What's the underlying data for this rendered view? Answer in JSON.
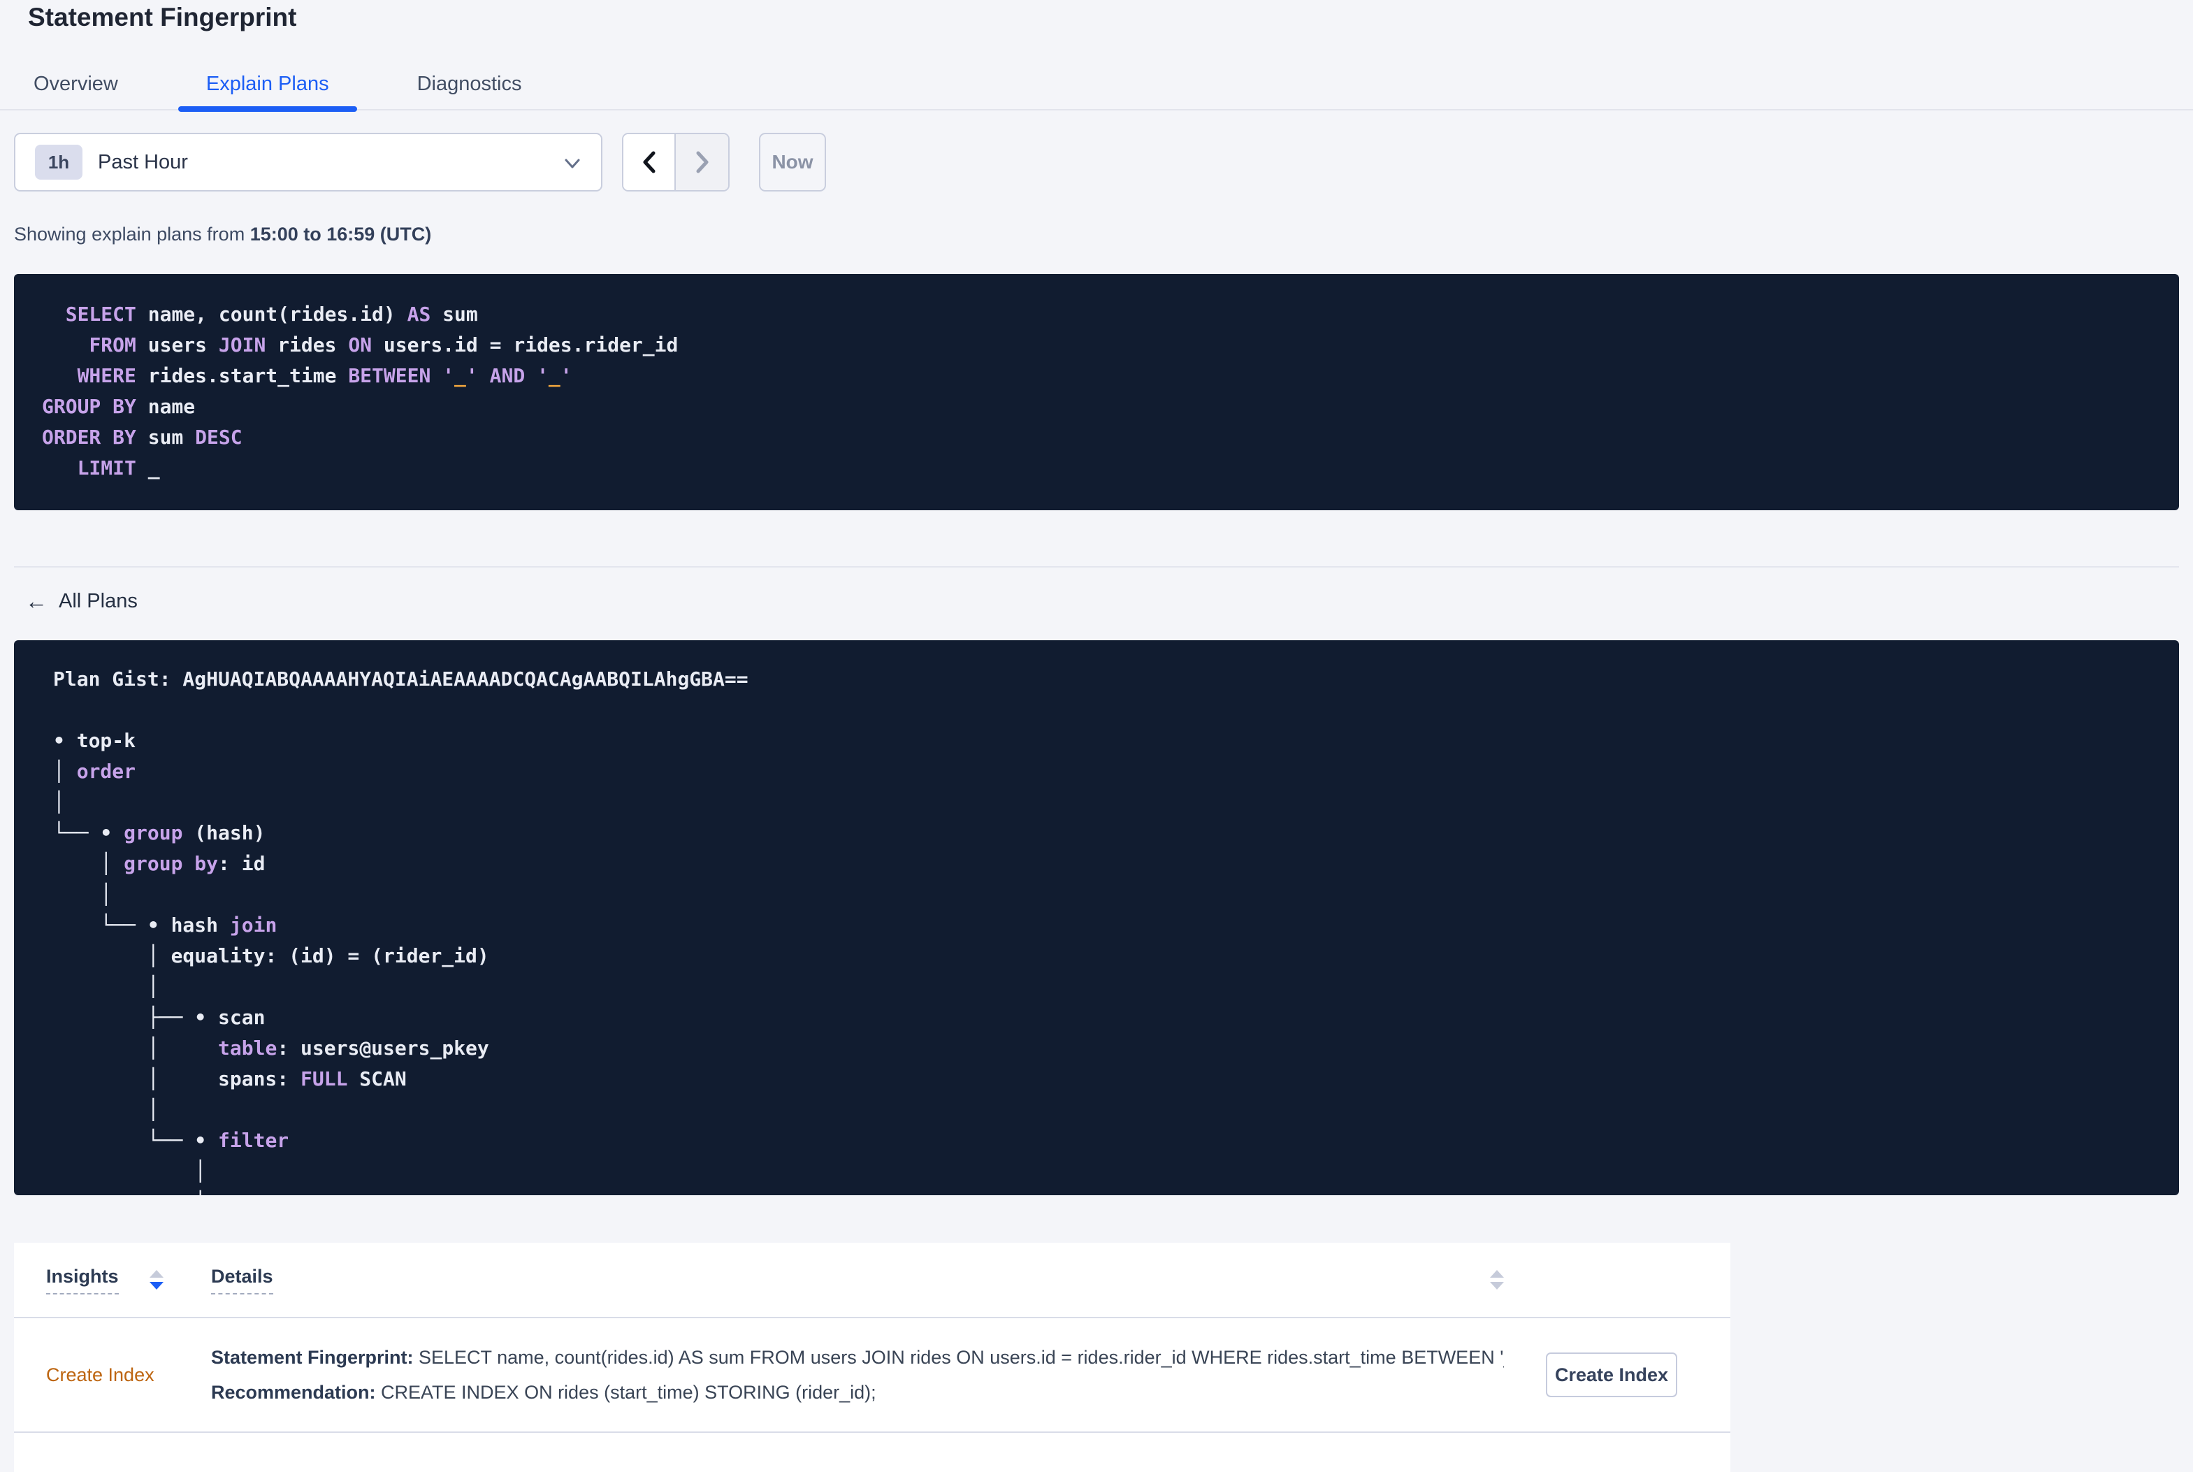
{
  "page": {
    "title": "Statement Fingerprint"
  },
  "tabs": {
    "items": [
      {
        "label": "Overview"
      },
      {
        "label": "Explain Plans"
      },
      {
        "label": "Diagnostics"
      }
    ],
    "active_label": "Explain Plans"
  },
  "time_controls": {
    "range_badge": "1h",
    "range_label": "Past Hour",
    "now_label": "Now"
  },
  "subtitle": {
    "prefix": "Showing explain plans from ",
    "range_bold": "15:00 to 16:59 (UTC)"
  },
  "sql_block": {
    "lines": [
      [
        {
          "t": "  ",
          "c": "i"
        },
        {
          "t": "SELECT",
          "c": "k"
        },
        {
          "t": " name, count(rides.id) ",
          "c": "i"
        },
        {
          "t": "AS",
          "c": "k"
        },
        {
          "t": " sum",
          "c": "i"
        }
      ],
      [
        {
          "t": "    ",
          "c": "i"
        },
        {
          "t": "FROM",
          "c": "k"
        },
        {
          "t": " users ",
          "c": "i"
        },
        {
          "t": "JOIN",
          "c": "k"
        },
        {
          "t": " rides ",
          "c": "i"
        },
        {
          "t": "ON",
          "c": "k"
        },
        {
          "t": " users.id = rides.rider_id",
          "c": "i"
        }
      ],
      [
        {
          "t": "   ",
          "c": "i"
        },
        {
          "t": "WHERE",
          "c": "k"
        },
        {
          "t": " rides.start_time ",
          "c": "i"
        },
        {
          "t": "BETWEEN",
          "c": "k"
        },
        {
          "t": " ",
          "c": "i"
        },
        {
          "t": "'",
          "c": "k"
        },
        {
          "t": "_",
          "c": "l"
        },
        {
          "t": "'",
          "c": "k"
        },
        {
          "t": " ",
          "c": "i"
        },
        {
          "t": "AND",
          "c": "k"
        },
        {
          "t": " ",
          "c": "i"
        },
        {
          "t": "'",
          "c": "k"
        },
        {
          "t": "_",
          "c": "l"
        },
        {
          "t": "'",
          "c": "k"
        }
      ],
      [
        {
          "t": "GROUP BY",
          "c": "k"
        },
        {
          "t": " name",
          "c": "i"
        }
      ],
      [
        {
          "t": "ORDER BY",
          "c": "k"
        },
        {
          "t": " sum ",
          "c": "i"
        },
        {
          "t": "DESC",
          "c": "k"
        }
      ],
      [
        {
          "t": "   ",
          "c": "i"
        },
        {
          "t": "LIMIT",
          "c": "k"
        },
        {
          "t": " _",
          "c": "i"
        }
      ]
    ]
  },
  "back_link": {
    "label": "All Plans",
    "icon": "←"
  },
  "plan_block": {
    "lines": [
      [
        {
          "t": "Plan Gist: AgHUAQIABQAAAAHYAQIAiAEAAAADCQACAgAABQILAhgGBA==",
          "c": "i"
        }
      ],
      [],
      [
        {
          "t": "• top-k",
          "c": "i"
        }
      ],
      [
        {
          "t": "│ ",
          "c": "i"
        },
        {
          "t": "order",
          "c": "k"
        }
      ],
      [
        {
          "t": "│",
          "c": "i"
        }
      ],
      [
        {
          "t": "└── • ",
          "c": "i"
        },
        {
          "t": "group",
          "c": "k"
        },
        {
          "t": " (hash)",
          "c": "i"
        }
      ],
      [
        {
          "t": "    │ ",
          "c": "i"
        },
        {
          "t": "group by",
          "c": "k"
        },
        {
          "t": ": id",
          "c": "i"
        }
      ],
      [
        {
          "t": "    │",
          "c": "i"
        }
      ],
      [
        {
          "t": "    └── • hash ",
          "c": "i"
        },
        {
          "t": "join",
          "c": "k"
        }
      ],
      [
        {
          "t": "        │ equality: (id) = (rider_id)",
          "c": "i"
        }
      ],
      [
        {
          "t": "        │",
          "c": "i"
        }
      ],
      [
        {
          "t": "        ├── • scan",
          "c": "i"
        }
      ],
      [
        {
          "t": "        │     ",
          "c": "i"
        },
        {
          "t": "table",
          "c": "k"
        },
        {
          "t": ": users@users_pkey",
          "c": "i"
        }
      ],
      [
        {
          "t": "        │     spans: ",
          "c": "i"
        },
        {
          "t": "FULL",
          "c": "k"
        },
        {
          "t": " SCAN",
          "c": "i"
        }
      ],
      [
        {
          "t": "        │",
          "c": "i"
        }
      ],
      [
        {
          "t": "        └── • ",
          "c": "i"
        },
        {
          "t": "filter",
          "c": "k"
        }
      ],
      [
        {
          "t": "            │",
          "c": "i"
        }
      ],
      [
        {
          "t": "            │",
          "c": "i"
        }
      ]
    ]
  },
  "insights_table": {
    "headers": [
      {
        "label": "Insights",
        "sort": "desc"
      },
      {
        "label": "Details",
        "sort": "none"
      }
    ],
    "row": {
      "insight_type": "Create Index",
      "fingerprint_label": "Statement Fingerprint:",
      "fingerprint_text": " SELECT name, count(rides.id) AS sum FROM users JOIN rides ON users.id = rides.rider_id WHERE rides.start_time BETWEEN '_…",
      "recommendation_label": "Recommendation:",
      "recommendation_text": " CREATE INDEX ON rides (start_time) STORING (rider_id);",
      "action_label": "Create Index"
    }
  },
  "colors": {
    "accent_blue": "#1c5ef5",
    "insight_orange": "#bd6510",
    "code_background": "#111c30",
    "code_keyword": "#c7a3ea",
    "code_text": "#e9ecf4",
    "code_literal": "#eea43e",
    "page_background": "#f4f5f9"
  }
}
